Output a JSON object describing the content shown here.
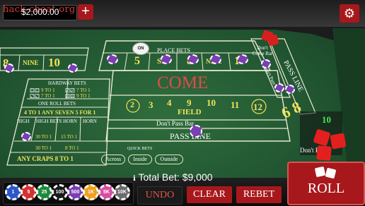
{
  "watermark": "hack-cheat.org",
  "balance": "$2,000.00",
  "top_buttons": {
    "add_symbol": "+",
    "settings_symbol": "⚙"
  },
  "place_bets": {
    "title": "PLACE BETS",
    "numbers": [
      "4",
      "5",
      "SIX",
      "8",
      "NINE",
      "10"
    ],
    "dont_come_bar": "Don't Come Bar"
  },
  "puck": "ON",
  "left_numbers": {
    "eight": "8",
    "nine": "NINE",
    "ten": "10"
  },
  "hardway": {
    "title": "HARDWAY BETS",
    "odds": [
      "9 TO 1",
      "7 TO 1",
      "7 TO 1",
      "9 TO 1"
    ]
  },
  "one_roll": {
    "title": "ONE ROLL BETS",
    "any_seven": "4 TO 1 ANY SEVEN 5 FOR 1",
    "hi_lo": "HIGH",
    "hi_lo_mid": "HIGH BETS HORN",
    "horn": "HORN",
    "odds_a": "30 TO 1",
    "odds_b": "15 TO 1",
    "odds_c": "30 TO 1",
    "odds_d": "8 TO 1",
    "any_craps": "ANY CRAPS 8 TO 1"
  },
  "come": {
    "title": "COME",
    "field_numbers": [
      "2",
      "3",
      "4",
      "9",
      "10",
      "11",
      "12"
    ],
    "field_label": "FIELD",
    "dont_pass_bar": "Don't Pass Bar",
    "pass_line": "PASS LINE"
  },
  "right": {
    "dont_pass_bar": "Don't Pass Bar",
    "pass_line": "PASS LINE",
    "big": "6 8",
    "point_number": "10",
    "dont_ps": "Don't Pass"
  },
  "quick_bets": {
    "title": "QUICK BETS",
    "buttons": [
      "Across",
      "Inside",
      "Outside"
    ]
  },
  "total_bet": {
    "icon": "ℹ",
    "text": "Total Bet: $9,000"
  },
  "actions": {
    "undo": "UNDO",
    "clear": "CLEAR",
    "rebet": "REBET",
    "roll": "ROLL"
  },
  "chip_rail": [
    {
      "label": "1",
      "color": "#2d58c7"
    },
    {
      "label": "5",
      "color": "#d3322f"
    },
    {
      "label": "25",
      "color": "#1f8a3c"
    },
    {
      "label": "100",
      "color": "#1a1a1a"
    },
    {
      "label": "500",
      "color": "#7a3fb0"
    },
    {
      "label": "1K",
      "color": "#f0a020"
    },
    {
      "label": "5K",
      "color": "#d74fa0"
    },
    {
      "label": "10K",
      "color": "#6b6b6b"
    }
  ],
  "colors": {
    "red_button": "#a7181c",
    "felt": "#2a6338",
    "yellow": "#f2e35a"
  }
}
